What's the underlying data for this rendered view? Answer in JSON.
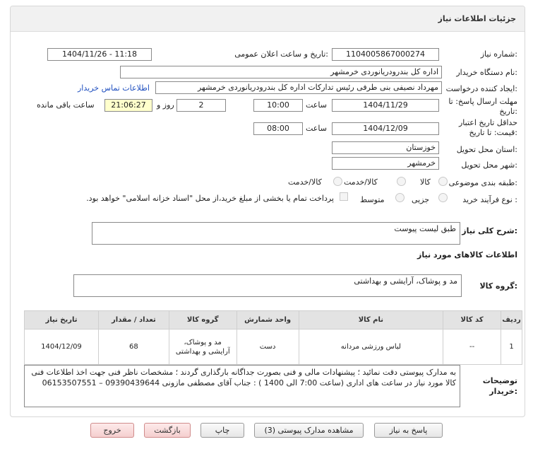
{
  "header": {
    "title": "جزئیات اطلاعات نیاز"
  },
  "fields": {
    "need_number_label": "شماره نیاز:",
    "need_number": "1104005867000274",
    "announce_label": "تاریخ و ساعت اعلان عمومی:",
    "announce_value": "1404/11/26 - 11:18",
    "buyer_org_label": "نام دستگاه خریدار:",
    "buyer_org": "اداره کل بندرودریانوردی خرمشهر",
    "creator_label": "ایجاد کننده درخواست:",
    "creator": "مهرداد  نصیفی بنی طرفی رئیس تدارکات اداره کل بندرودریانوردی خرمشهر",
    "contact_link": "اطلاعات تماس خریدار",
    "reply_deadline_label": "مهلت ارسال پاسخ: تا تاریخ:",
    "reply_date": "1404/11/29",
    "time_label": "ساعت",
    "reply_time": "10:00",
    "days_value": "2",
    "days_label": "روز و",
    "remaining_time": "21:06:27",
    "remaining_label": "ساعت باقی مانده",
    "validity_label": "حداقل تاریخ اعتبار قیمت: تا تاریخ:",
    "validity_date": "1404/12/09",
    "validity_time": "08:00",
    "province_label": "استان محل تحویل:",
    "province": "خوزستان",
    "city_label": "شهر محل تحویل:",
    "city": "خرمشهر",
    "category_label": "طبقه بندی موضوعی:",
    "category_options": [
      "کالا",
      "کالا/خدمت"
    ],
    "process_label": "نوع فرآیند خرید :",
    "process_options": [
      "جزیی",
      "متوسط"
    ],
    "payment_note": "پرداخت تمام یا بخشی از مبلغ خرید،از محل \"اسناد خزانه اسلامی\" خواهد بود."
  },
  "description": {
    "label": "شرح کلی نیاز:",
    "value": "طبق لیست پیوست"
  },
  "goods_info": {
    "title": "اطلاعات کالاهای مورد نیاز",
    "group_label": "گروه کالا:",
    "group_value": "مد و پوشاک، آرایشی و بهداشتی"
  },
  "table": {
    "headers": [
      "ردیف",
      "کد کالا",
      "نام کالا",
      "واحد شمارش",
      "گروه کالا",
      "تعداد / مقدار",
      "تاریخ نیاز"
    ],
    "rows": [
      [
        "1",
        "--",
        "لباس ورزشی مردانه",
        "دست",
        "مد و پوشاک، آرایشی و بهداشتی",
        "68",
        "1404/12/09"
      ]
    ]
  },
  "buyer_notes": {
    "label": "توضیحات خریدار:",
    "value": "به مدارک پیوستی دقت نمائید ؛ پیشنهادات مالی و فنی بصورت جداگانه بارگذاری گردند ؛ مشخصات ناظر فنی جهت اخذ اطلاعات فنی کالا مورد نیاز در ساعت های اداری (ساعت 7:00 الی 1400 ) : جناب آقای مصطفی مازونی 09390439644 – 06153507551"
  },
  "buttons": {
    "reply": "پاسخ به نیاز",
    "view_docs": "مشاهده مدارک پیوستی (3)",
    "print": "چاپ",
    "back": "بازگشت",
    "exit": "خروج"
  },
  "colors": {
    "link": "#1f4fbf",
    "highlight": "#ffffcc",
    "header_bg": "#f1f1f1",
    "watermark": "#c23b3b"
  }
}
